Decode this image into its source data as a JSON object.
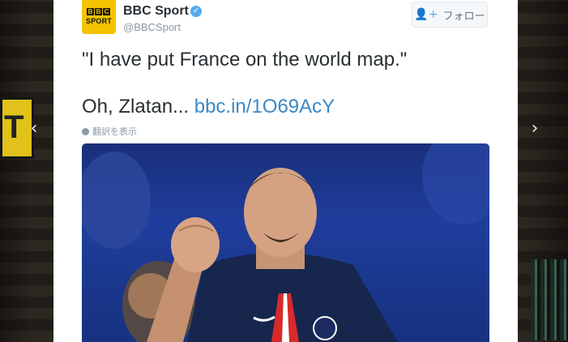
{
  "background": {
    "left_sign_text": "T",
    "left_arrow": "‹",
    "right_arrow": "›"
  },
  "tweet": {
    "author_name": "BBC Sport",
    "author_handle": "@BBCSport",
    "verified_icon": "verified-badge",
    "avatar_letters": [
      "B",
      "B",
      "C"
    ],
    "avatar_sport": "SPORT",
    "follow_label": "フォロー",
    "text_line1": "\"I have put France on the world map.\"",
    "text_line2_prefix": "Oh, Zlatan...",
    "text_link": "bbc.in/1O69AcY",
    "translate_label": "翻訳を表示"
  },
  "colors": {
    "link": "#3b88c3",
    "verified": "#55acee",
    "avatar_bg": "#f3c300"
  }
}
